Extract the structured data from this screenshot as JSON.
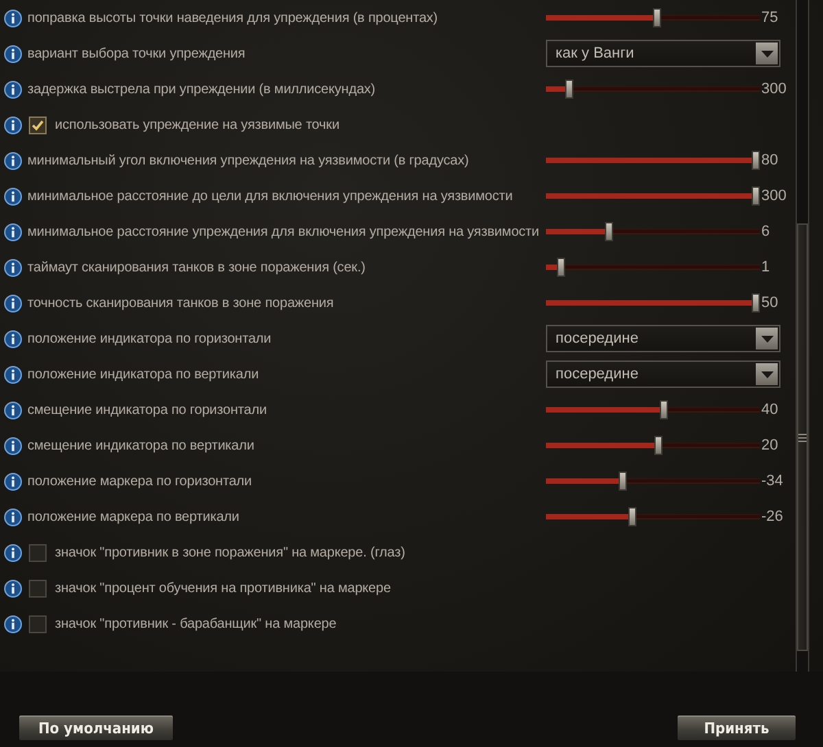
{
  "settings": [
    {
      "kind": "slider",
      "label": "поправка высоты точки наведения для упреждения (в процентах)",
      "level": 0.52,
      "reading": "75"
    },
    {
      "kind": "dropdown",
      "label": "вариант выбора точки упреждения",
      "value": "как у Ванги"
    },
    {
      "kind": "slider",
      "label": "задержка выстрела при упреждении (в миллисекундах)",
      "level": 0.09,
      "reading": "300"
    },
    {
      "kind": "checkbox",
      "label": "использовать упреждение на уязвимые точки",
      "checked": true
    },
    {
      "kind": "slider",
      "label": "минимальный угол включения упреждения на уязвимости (в градусах)",
      "level": 1.0,
      "reading": "80"
    },
    {
      "kind": "slider",
      "label": "минимальное расстояние до цели для включения упреждения на уязвимости",
      "level": 1.0,
      "reading": "300"
    },
    {
      "kind": "slider",
      "label": "минимальное расстояние упреждения для включения упреждения на уязвимости",
      "level": 0.29,
      "reading": "6"
    },
    {
      "kind": "slider",
      "label": "таймаут сканирования танков в зоне поражения (сек.)",
      "level": 0.05,
      "reading": "1"
    },
    {
      "kind": "slider",
      "label": "точность сканирования танков в зоне поражения",
      "level": 1.0,
      "reading": "50"
    },
    {
      "kind": "dropdown",
      "label": "положение индикатора по горизонтали",
      "value": "посередине"
    },
    {
      "kind": "dropdown",
      "label": "положение индикатора по вертикали",
      "value": "посередине"
    },
    {
      "kind": "slider",
      "label": "смещение индикатора по горизонтали",
      "level": 0.55,
      "reading": "40"
    },
    {
      "kind": "slider",
      "label": "смещение индикатора по вертикали",
      "level": 0.53,
      "reading": "20"
    },
    {
      "kind": "slider",
      "label": "положение маркера по горизонтали",
      "level": 0.35,
      "reading": "-34"
    },
    {
      "kind": "slider",
      "label": "положение маркера по вертикали",
      "level": 0.4,
      "reading": "-26"
    },
    {
      "kind": "checkbox",
      "label": "значок \"противник в зоне поражения\" на маркере. (глаз)",
      "checked": false
    },
    {
      "kind": "checkbox",
      "label": "значок \"процент обучения на противника\" на маркере",
      "checked": false
    },
    {
      "kind": "checkbox",
      "label": "значок \"противник - барабанщик\" на маркере",
      "checked": false
    }
  ],
  "buttons": [
    {
      "label": "По умолчанию"
    },
    {
      "label": "Принять"
    }
  ]
}
